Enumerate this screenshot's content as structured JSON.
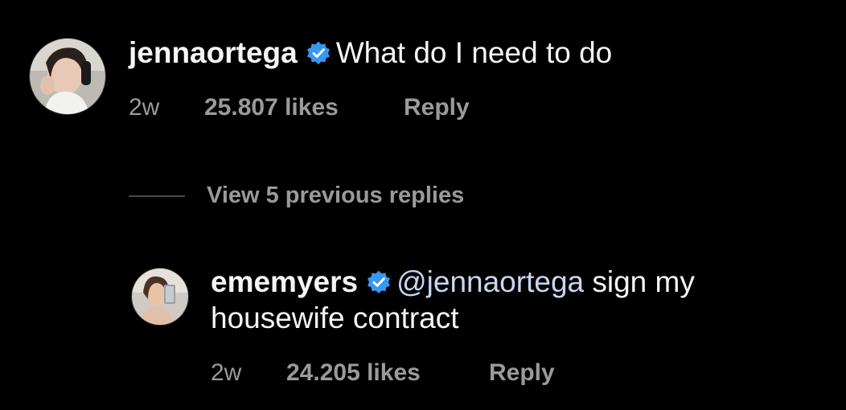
{
  "theme": {
    "background": "#000000",
    "text_primary": "#f5f5f5",
    "text_secondary": "#9a9a9a",
    "mention_color": "#c9d6f2",
    "verified_color": "#3897f0"
  },
  "comment": {
    "username": "jennaortega",
    "verified": true,
    "text": "What do I need to do",
    "time": "2w",
    "likes": "25.807 likes",
    "reply_label": "Reply",
    "avatar_icon": "profile-photo"
  },
  "thread": {
    "view_previous_label": "View 5 previous replies"
  },
  "reply": {
    "username": "ememyers",
    "verified": true,
    "mention": "@jennaortega",
    "text_line1": " sign my",
    "text_line2": "housewife contract",
    "time": "2w",
    "likes": "24.205 likes",
    "reply_label": "Reply",
    "avatar_icon": "profile-photo"
  }
}
